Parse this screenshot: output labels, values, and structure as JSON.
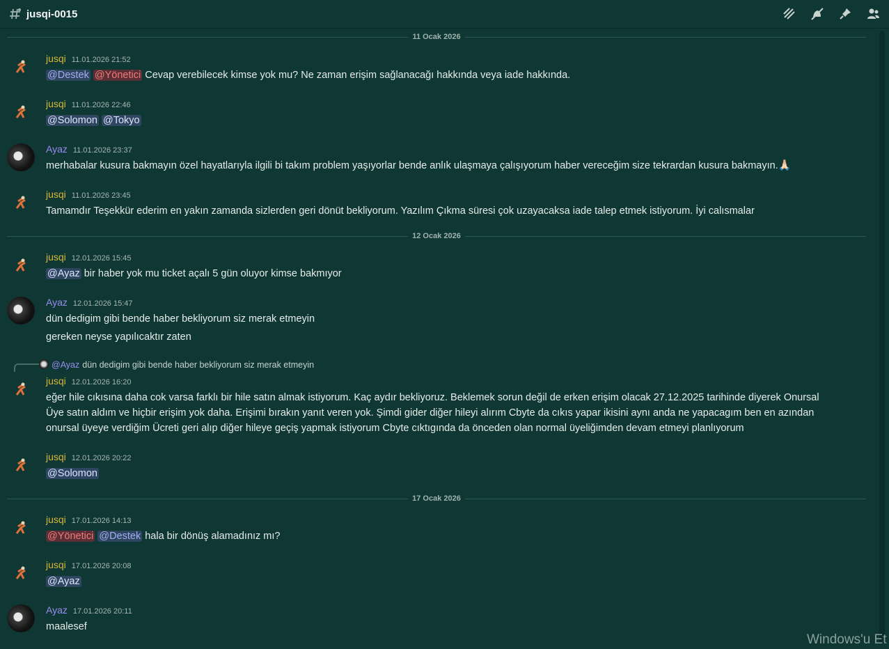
{
  "header": {
    "channel_name": "jusqi-0015",
    "icons": [
      "threads-icon",
      "mute-icon",
      "pin-icon",
      "members-icon"
    ]
  },
  "dividers": [
    "11 Ocak 2026",
    "12 Ocak 2026",
    "17 Ocak 2026"
  ],
  "messages": [
    {
      "user": "jusqi",
      "time": "11.01.2026 21:52",
      "mentions": [
        "@Destek",
        "@Yönetici"
      ],
      "text": "Cevap verebilecek kimse yok mu? Ne zaman erişim sağlanacağı hakkında veya iade hakkında."
    },
    {
      "user": "jusqi",
      "time": "11.01.2026 22:46",
      "mentions": [
        "@Solomon",
        "@Tokyo"
      ],
      "text": ""
    },
    {
      "user": "Ayaz",
      "time": "11.01.2026 23:37",
      "text": "merhabalar kusura bakmayın özel hayatlarıyla ilgili bi takım problem yaşıyorlar bende anlık ulaşmaya çalışıyorum haber vereceğim size tekrardan kusura bakmayın.",
      "emoji": "🙏🏻"
    },
    {
      "user": "jusqi",
      "time": "11.01.2026 23:45",
      "text": "Tamamdır Teşekkür ederim en yakın zamanda sizlerden geri dönüt bekliyorum. Yazılım Çıkma süresi çok uzayacaksa iade talep etmek istiyorum. İyi calısmalar"
    },
    {
      "user": "jusqi",
      "time": "12.01.2026 15:45",
      "mentions": [
        "@Ayaz"
      ],
      "text": "bir haber yok mu ticket açalı 5 gün oluyor kimse bakmıyor"
    },
    {
      "user": "Ayaz",
      "time": "12.01.2026 15:47",
      "text": "dün dedigim gibi bende haber bekliyorum siz merak etmeyin",
      "text2": "gereken neyse yapılıcaktır zaten"
    },
    {
      "user": "jusqi",
      "time": "12.01.2026 16:20",
      "reply_name": "@Ayaz",
      "reply_text": "dün dedigim gibi bende haber bekliyorum siz merak etmeyin",
      "lines": [
        "eğer hile cıkısına daha cok varsa farklı bir hile satın almak istiyorum. Kaç aydır bekliyoruz. Beklemek sorun değil de erken erişim olacak 27.12.2025 tarihinde diyerek Onursal",
        "Üye satın aldım ve hiçbir erişim yok daha. Erişimi bırakın yanıt veren yok. Şimdi gider diğer hileyi alırım Cbyte da cıkıs yapar ikisini aynı anda ne yapacagım ben en azından",
        "onursal üyeye verdiğim Ücreti geri alıp diğer hileye geçiş yapmak istiyorum Cbyte cıktıgında da önceden olan normal üyeliğimden devam etmeyi planlıyorum"
      ]
    },
    {
      "user": "jusqi",
      "time": "12.01.2026 20:22",
      "mentions": [
        "@Solomon"
      ],
      "text": ""
    },
    {
      "user": "jusqi",
      "time": "17.01.2026 14:13",
      "mentions": [
        "@Yönetici",
        "@Destek"
      ],
      "text": "hala bir dönüş alamadınız mı?"
    },
    {
      "user": "jusqi",
      "time": "17.01.2026 20:08",
      "mentions": [
        "@Ayaz"
      ],
      "text": ""
    },
    {
      "user": "Ayaz",
      "time": "17.01.2026 20:11",
      "text": "maalesef"
    }
  ],
  "watermark": "Windows'u Et"
}
